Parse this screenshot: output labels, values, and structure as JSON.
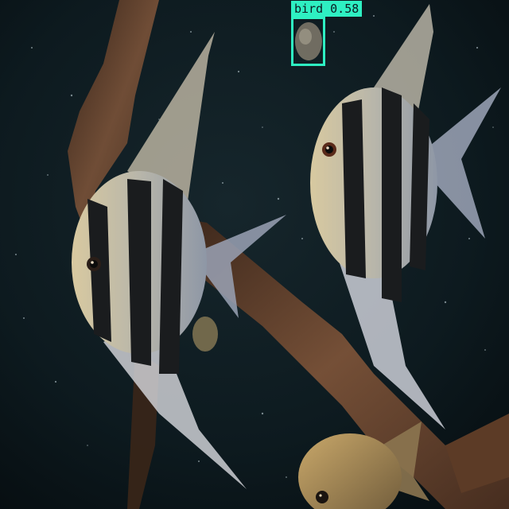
{
  "scene": {
    "description_colors": {
      "water": "#0b1418",
      "driftwood": "#5a3a28",
      "fish_body": "#c9c2a8",
      "fish_stripe": "#1a1c1e",
      "box": "#2ef0c2"
    }
  },
  "detections": [
    {
      "class": "bird",
      "score": "0.58",
      "label": "bird 0.58"
    }
  ]
}
